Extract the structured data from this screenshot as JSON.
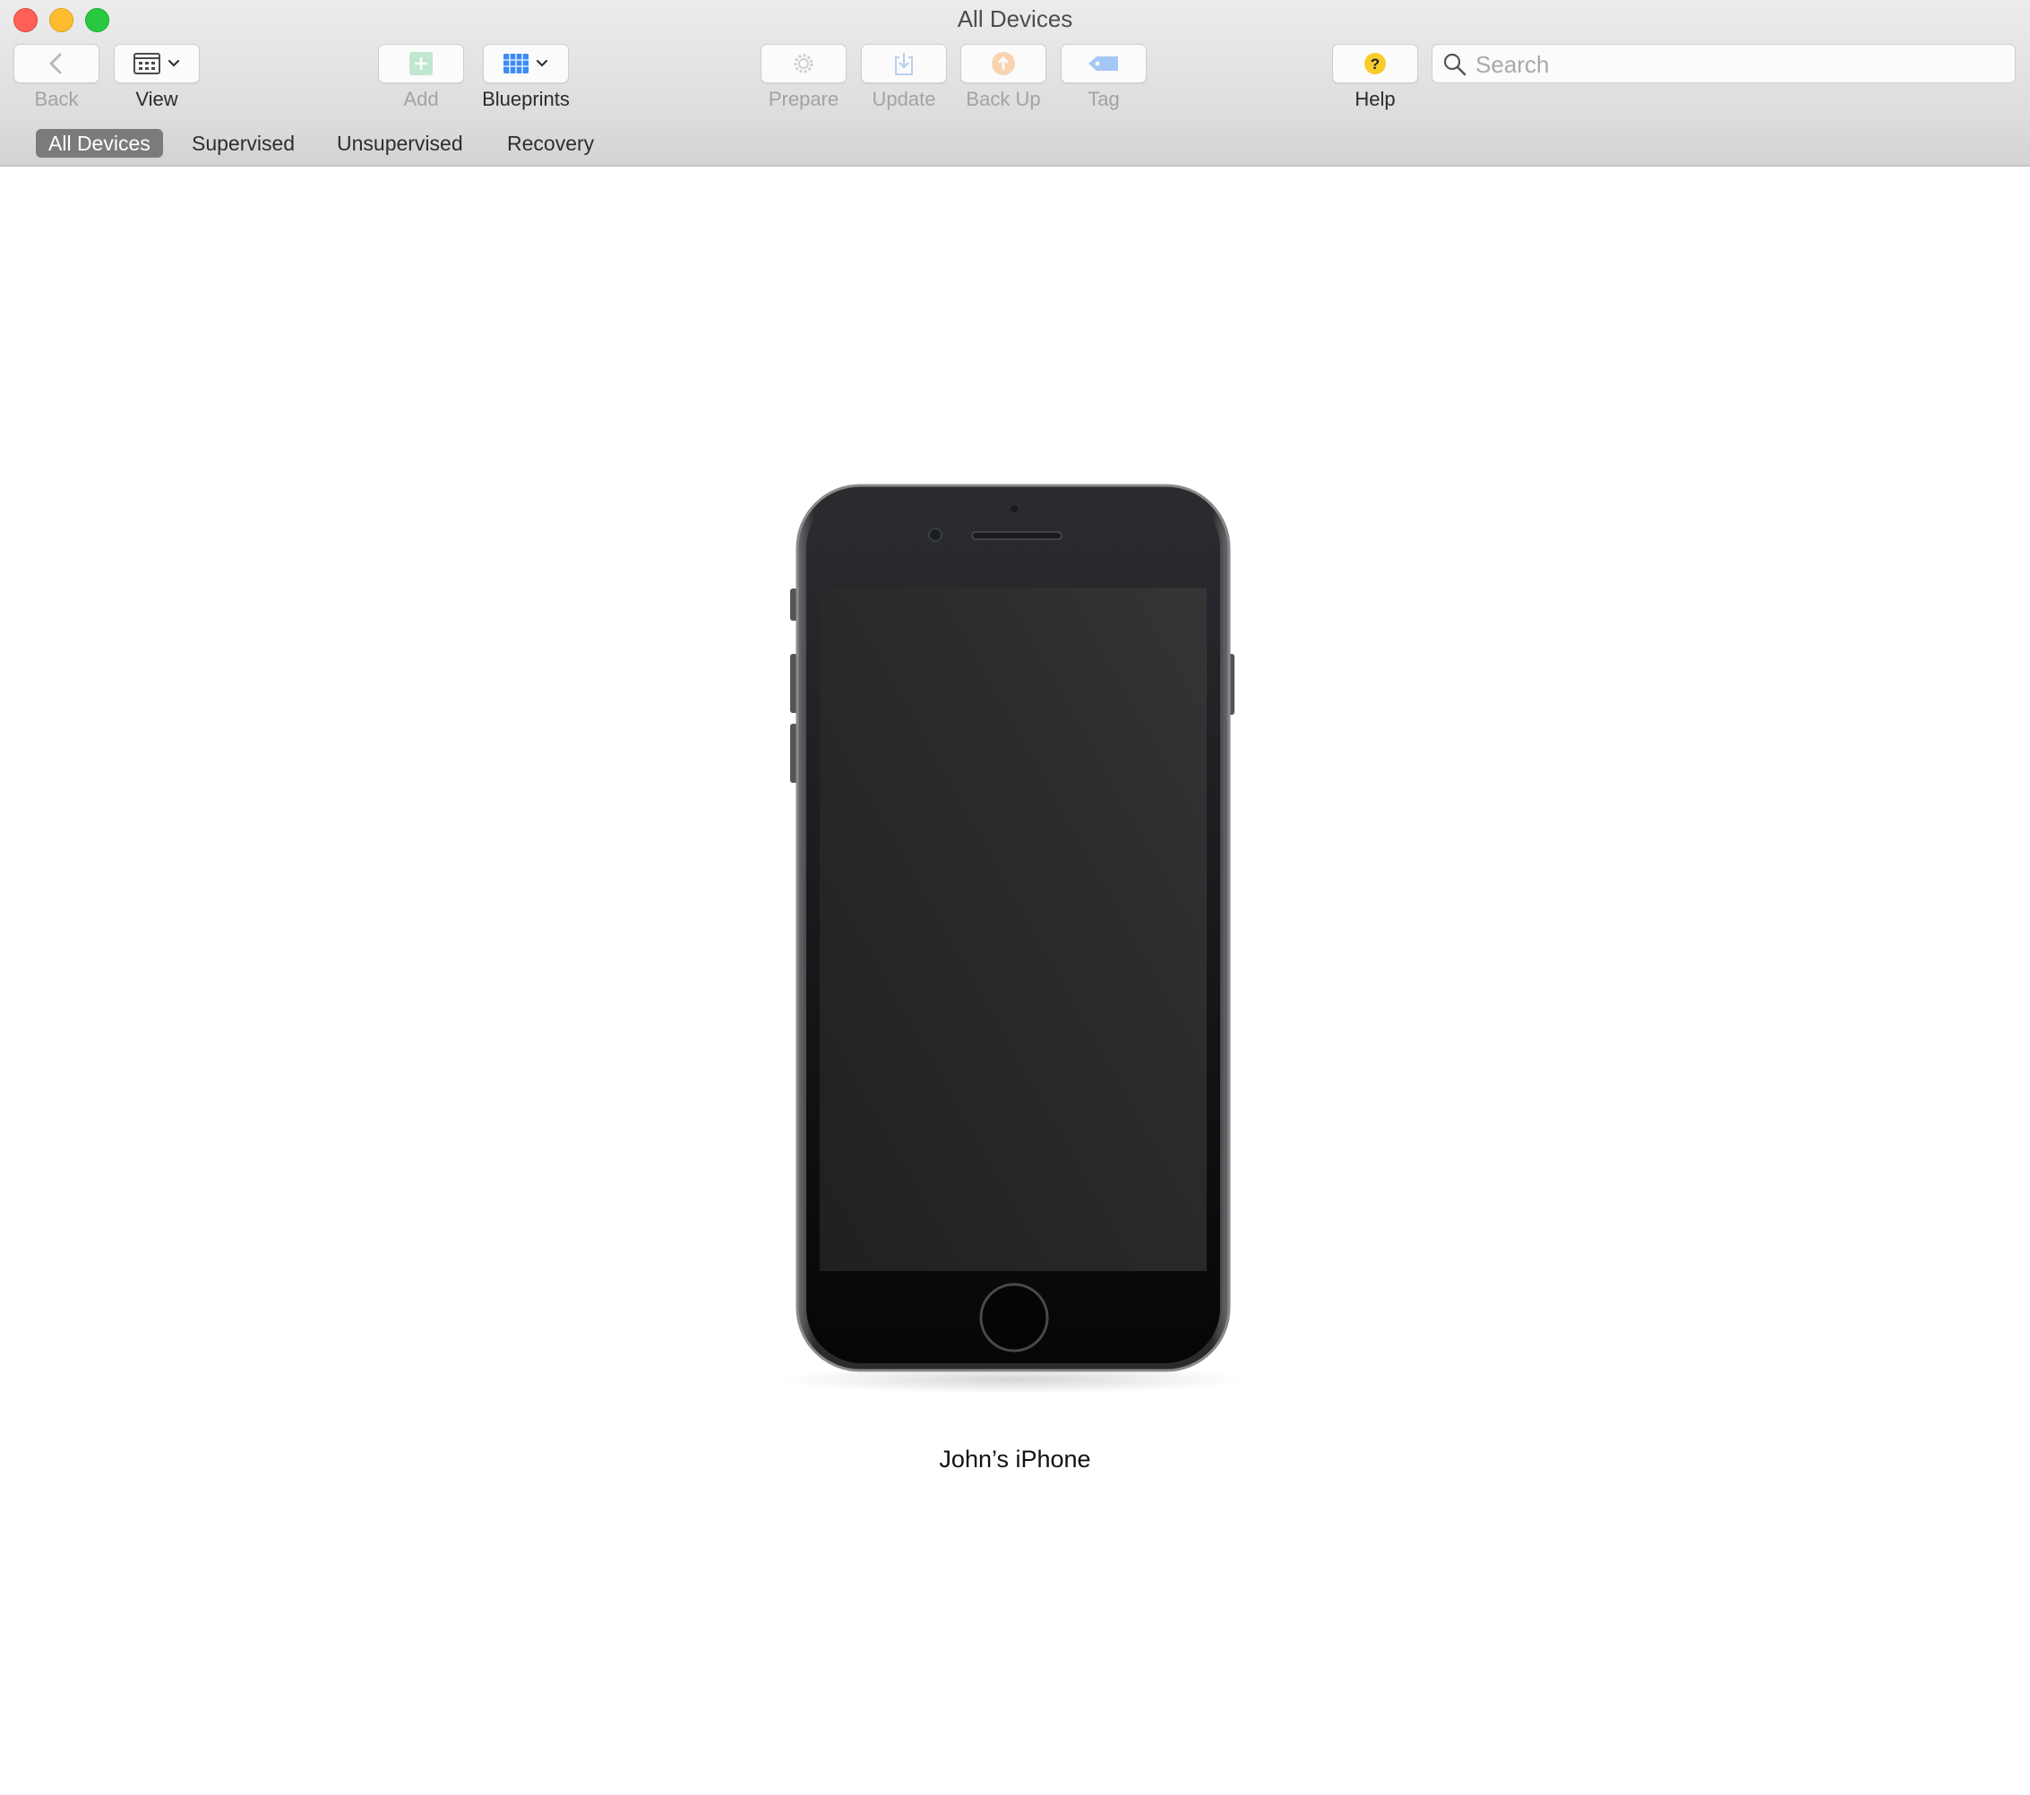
{
  "window": {
    "title": "All Devices"
  },
  "toolbar": {
    "back": {
      "label": "Back",
      "icon": "chevron-left-icon"
    },
    "view": {
      "label": "View",
      "icon": "grid-calendar-icon"
    },
    "add": {
      "label": "Add",
      "icon": "plus-icon"
    },
    "blueprints": {
      "label": "Blueprints",
      "icon": "blueprint-grid-icon"
    },
    "prepare": {
      "label": "Prepare",
      "icon": "gear-icon"
    },
    "update": {
      "label": "Update",
      "icon": "download-icon"
    },
    "backup": {
      "label": "Back Up",
      "icon": "upload-arrow-icon"
    },
    "tag": {
      "label": "Tag",
      "icon": "tag-icon"
    },
    "help": {
      "label": "Help",
      "icon": "question-icon"
    }
  },
  "search": {
    "placeholder": "Search",
    "value": ""
  },
  "scopes": [
    "All Devices",
    "Supervised",
    "Unsupervised",
    "Recovery"
  ],
  "active_scope": "All Devices",
  "device": {
    "name": "John’s iPhone"
  },
  "colors": {
    "accent_green": "#79d39a",
    "accent_blue": "#3d8bf2",
    "accent_orange": "#f6a35a",
    "accent_yellow": "#f9cc2e",
    "scope_active": "#7b7b7b"
  }
}
